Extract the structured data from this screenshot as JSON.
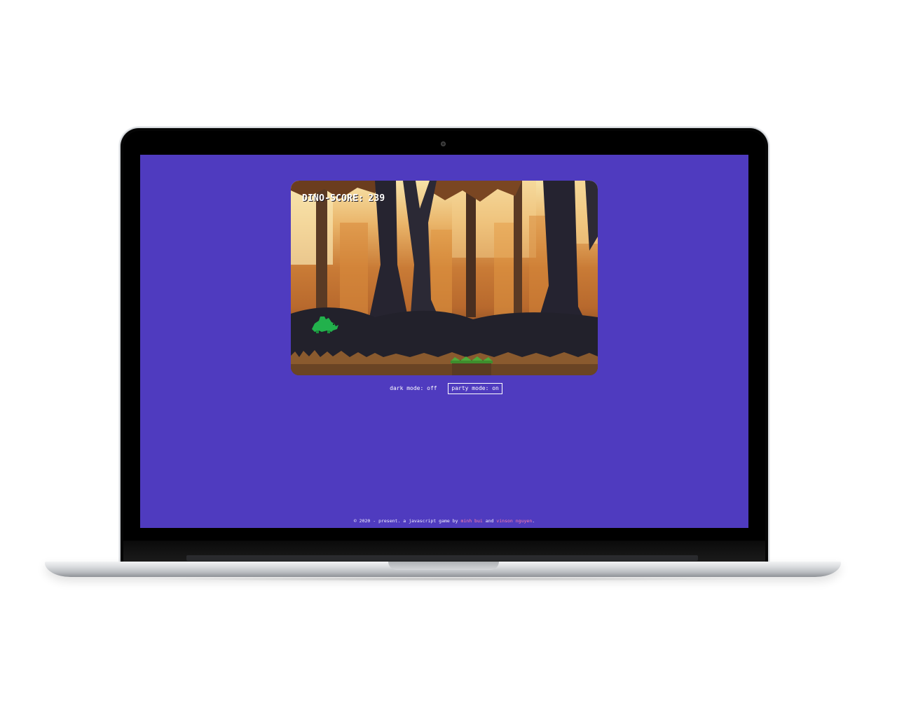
{
  "game": {
    "score_label": "DINO-SCORE:",
    "score_value": "239"
  },
  "controls": {
    "dark_mode": "dark mode: off",
    "party_mode": "party mode: on"
  },
  "footer": {
    "prefix": "© 2020 - present. a javascript game by ",
    "author1": "minh bui",
    "joiner": " and ",
    "author2": "vinson nguyen",
    "suffix": "."
  },
  "colors": {
    "page_background": "#4f3bbf",
    "dino": "#22b14c",
    "author_link": "#ff7fa8",
    "forest_light": "#f7e3a9",
    "forest_mid": "#c97b36",
    "tree_dark": "#2a2630"
  },
  "icons": {
    "player": "dino-sprite",
    "obstacle": "grass-block-sprite",
    "camera": "camera-icon"
  }
}
